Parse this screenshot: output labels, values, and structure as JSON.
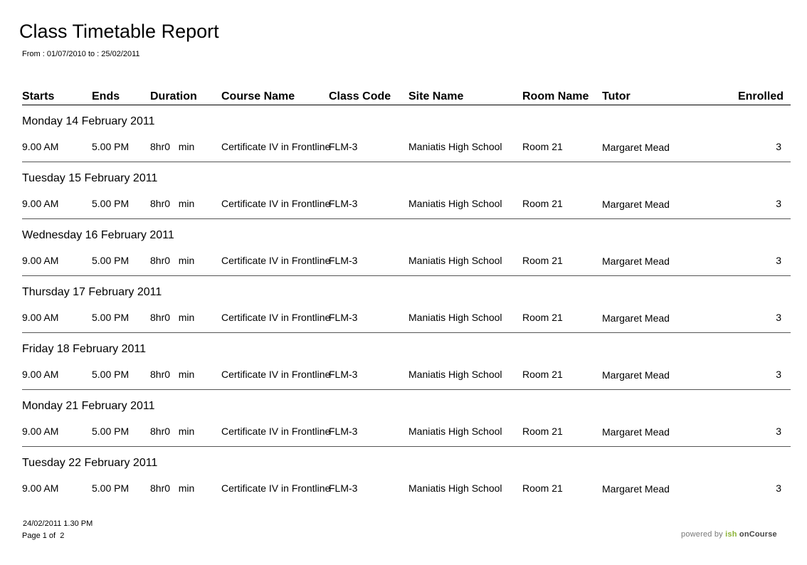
{
  "report": {
    "title": "Class Timetable Report",
    "date_range": "From : 01/07/2010 to : 25/02/2011"
  },
  "columns": {
    "starts": "Starts",
    "ends": "Ends",
    "duration": "Duration",
    "course_name": "Course Name",
    "class_code": "Class Code",
    "site_name": "Site Name",
    "room_name": "Room Name",
    "tutor": "Tutor",
    "enrolled": "Enrolled"
  },
  "groups": [
    {
      "day": "Monday 14 February 2011",
      "starts": "9.00 AM",
      "ends": "5.00 PM",
      "duration": "8hr0   min",
      "course": "Certificate IV in Frontline",
      "class_code": "FLM-3",
      "site": "Maniatis High School",
      "room": "Room 21",
      "tutor": "Margaret Mead",
      "enrolled": "3"
    },
    {
      "day": "Tuesday 15 February 2011",
      "starts": "9.00 AM",
      "ends": "5.00 PM",
      "duration": "8hr0   min",
      "course": "Certificate IV in Frontline",
      "class_code": "FLM-3",
      "site": "Maniatis High School",
      "room": "Room 21",
      "tutor": "Margaret Mead",
      "enrolled": "3"
    },
    {
      "day": "Wednesday 16 February 2011",
      "starts": "9.00 AM",
      "ends": "5.00 PM",
      "duration": "8hr0   min",
      "course": "Certificate IV in Frontline",
      "class_code": "FLM-3",
      "site": "Maniatis High School",
      "room": "Room 21",
      "tutor": "Margaret Mead",
      "enrolled": "3"
    },
    {
      "day": "Thursday 17 February 2011",
      "starts": "9.00 AM",
      "ends": "5.00 PM",
      "duration": "8hr0   min",
      "course": "Certificate IV in Frontline",
      "class_code": "FLM-3",
      "site": "Maniatis High School",
      "room": "Room 21",
      "tutor": "Margaret Mead",
      "enrolled": "3"
    },
    {
      "day": "Friday 18 February 2011",
      "starts": "9.00 AM",
      "ends": "5.00 PM",
      "duration": "8hr0   min",
      "course": "Certificate IV in Frontline",
      "class_code": "FLM-3",
      "site": "Maniatis High School",
      "room": "Room 21",
      "tutor": "Margaret Mead",
      "enrolled": "3"
    },
    {
      "day": "Monday 21 February 2011",
      "starts": "9.00 AM",
      "ends": "5.00 PM",
      "duration": "8hr0   min",
      "course": "Certificate IV in Frontline",
      "class_code": "FLM-3",
      "site": "Maniatis High School",
      "room": "Room 21",
      "tutor": "Margaret Mead",
      "enrolled": "3"
    },
    {
      "day": "Tuesday 22 February 2011",
      "starts": "9.00 AM",
      "ends": "5.00 PM",
      "duration": "8hr0   min",
      "course": "Certificate IV in Frontline",
      "class_code": "FLM-3",
      "site": "Maniatis High School",
      "room": "Room 21",
      "tutor": "Margaret Mead",
      "enrolled": "3"
    }
  ],
  "footer": {
    "timestamp": "24/02/2011 1.30 PM",
    "page": "Page 1 of  2",
    "brand_powered": "powered by ",
    "brand_ish": "ish",
    "brand_product": " onCourse"
  },
  "colors": {
    "brand_green": "#8bb336",
    "rule": "#555555"
  }
}
